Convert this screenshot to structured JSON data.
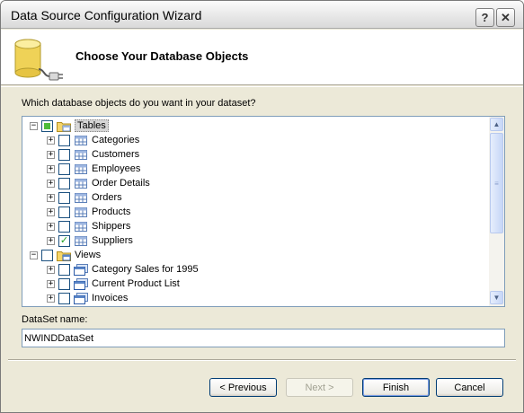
{
  "window": {
    "title": "Data Source Configuration Wizard",
    "help_glyph": "?",
    "close_glyph": "✕"
  },
  "header": {
    "title": "Choose Your Database Objects",
    "icon": "database-plug-icon"
  },
  "prompt": "Which database objects do you want in your dataset?",
  "tree": {
    "expanded_glyph": "−",
    "collapsed_glyph": "+",
    "check_glyph": "✓",
    "nodes": [
      {
        "label": "Tables",
        "level": 0,
        "expanded": true,
        "state": "partial",
        "icon": "folder-tables-icon",
        "selected": true
      },
      {
        "label": "Categories",
        "level": 1,
        "state": "unchecked",
        "icon": "table-icon"
      },
      {
        "label": "Customers",
        "level": 1,
        "state": "unchecked",
        "icon": "table-icon"
      },
      {
        "label": "Employees",
        "level": 1,
        "state": "unchecked",
        "icon": "table-icon"
      },
      {
        "label": "Order Details",
        "level": 1,
        "state": "unchecked",
        "icon": "table-icon"
      },
      {
        "label": "Orders",
        "level": 1,
        "state": "unchecked",
        "icon": "table-icon"
      },
      {
        "label": "Products",
        "level": 1,
        "state": "unchecked",
        "icon": "table-icon"
      },
      {
        "label": "Shippers",
        "level": 1,
        "state": "unchecked",
        "icon": "table-icon"
      },
      {
        "label": "Suppliers",
        "level": 1,
        "state": "checked",
        "icon": "table-icon"
      },
      {
        "label": "Views",
        "level": 0,
        "expanded": true,
        "state": "unchecked",
        "icon": "folder-views-icon"
      },
      {
        "label": "Category Sales for 1995",
        "level": 1,
        "state": "unchecked",
        "icon": "view-icon"
      },
      {
        "label": "Current Product List",
        "level": 1,
        "state": "unchecked",
        "icon": "view-icon"
      },
      {
        "label": "Invoices",
        "level": 1,
        "state": "unchecked",
        "icon": "view-icon"
      }
    ]
  },
  "scrollbar": {
    "up": "▲",
    "down": "▼",
    "grip": "≡"
  },
  "dataset": {
    "label": "DataSet name:",
    "value": "NWINDDataSet"
  },
  "buttons": {
    "previous": "< Previous",
    "next": "Next >",
    "finish": "Finish",
    "cancel": "Cancel"
  }
}
